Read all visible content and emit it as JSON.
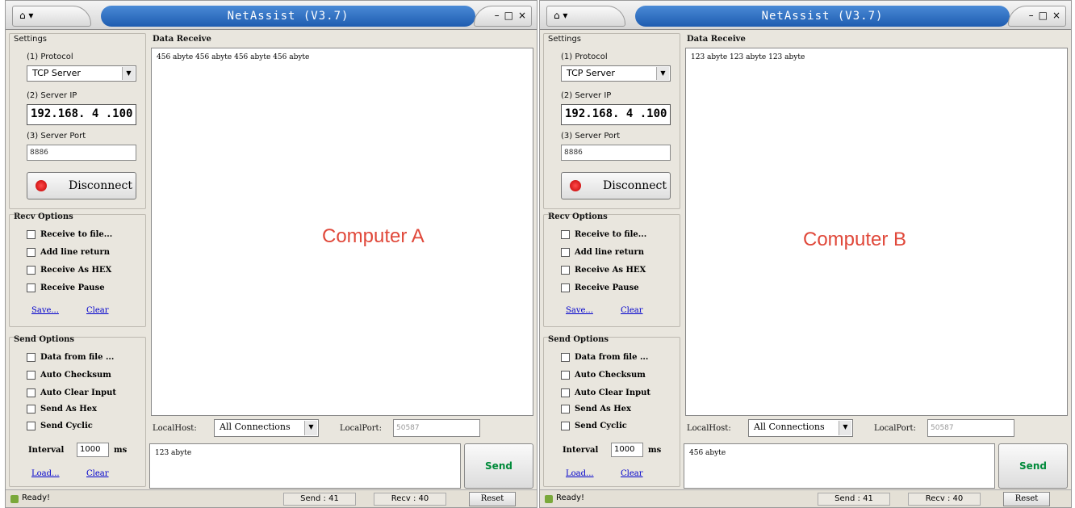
{
  "windows": [
    {
      "sys_menu": "⌂ ▾",
      "title": "NetAssist (V3.7)",
      "win_btns": {
        "min": "–",
        "max": "□",
        "close": "×"
      },
      "settings": {
        "group_title": "Settings",
        "protocol_label": "(1) Protocol",
        "protocol_value": "TCP Server",
        "server_ip_label": "(2) Server IP",
        "server_ip_value": "192.168. 4 .100",
        "server_port_label": "(3) Server Port",
        "server_port_value": "8886",
        "connect_button": "Disconnect"
      },
      "recv_options": {
        "group_title": "Recv Options",
        "items": [
          "Receive to file...",
          "Add line return",
          "Receive As HEX",
          "Receive Pause"
        ],
        "save_link": "Save...",
        "clear_link": "Clear"
      },
      "send_options": {
        "group_title": "Send Options",
        "items": [
          "Data from file ...",
          "Auto Checksum",
          "Auto Clear Input",
          "Send As Hex",
          "Send Cyclic"
        ],
        "interval_label": "Interval",
        "interval_value": "1000",
        "interval_unit": "ms",
        "load_link": "Load...",
        "clear_link": "Clear"
      },
      "data_receive": {
        "group_title": "Data Receive",
        "content": "456 abyte 456 abyte 456 abyte 456 abyte"
      },
      "overlay_label": "Computer A",
      "local_host_label": "LocalHost:",
      "local_host_value": "All Connections",
      "local_port_label": "LocalPort:",
      "local_port_value": "50587",
      "send_text": "123 abyte",
      "send_button": "Send",
      "status": {
        "ready": "Ready!",
        "send": "Send : 41",
        "recv": "Recv : 40",
        "reset": "Reset"
      }
    },
    {
      "sys_menu": "⌂ ▾",
      "title": "NetAssist (V3.7)",
      "win_btns": {
        "min": "–",
        "max": "□",
        "close": "×"
      },
      "settings": {
        "group_title": "Settings",
        "protocol_label": "(1) Protocol",
        "protocol_value": "TCP Server",
        "server_ip_label": "(2) Server IP",
        "server_ip_value": "192.168. 4 .100",
        "server_port_label": "(3) Server Port",
        "server_port_value": "8886",
        "connect_button": "Disconnect"
      },
      "recv_options": {
        "group_title": "Recv Options",
        "items": [
          "Receive to file...",
          "Add line return",
          "Receive As HEX",
          "Receive Pause"
        ],
        "save_link": "Save...",
        "clear_link": "Clear"
      },
      "send_options": {
        "group_title": "Send Options",
        "items": [
          "Data from file ...",
          "Auto Checksum",
          "Auto Clear Input",
          "Send As Hex",
          "Send Cyclic"
        ],
        "interval_label": "Interval",
        "interval_value": "1000",
        "interval_unit": "ms",
        "load_link": "Load...",
        "clear_link": "Clear"
      },
      "data_receive": {
        "group_title": "Data Receive",
        "content": "123 abyte 123 abyte 123 abyte"
      },
      "overlay_label": "Computer B",
      "local_host_label": "LocalHost:",
      "local_host_value": "All Connections",
      "local_port_label": "LocalPort:",
      "local_port_value": "50587",
      "send_text": "456 abyte",
      "send_button": "Send",
      "status": {
        "ready": "Ready!",
        "send": "Send : 41",
        "recv": "Recv : 40",
        "reset": "Reset"
      }
    }
  ]
}
